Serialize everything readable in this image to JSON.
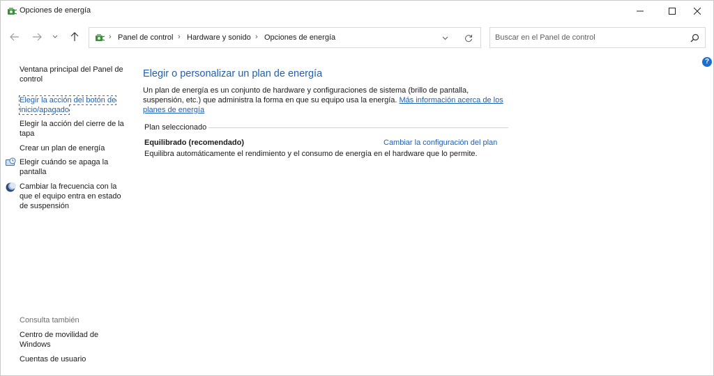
{
  "window": {
    "title": "Opciones de energía"
  },
  "breadcrumb": {
    "items": [
      "Panel de control",
      "Hardware y sonido",
      "Opciones de energía"
    ],
    "separator": "›"
  },
  "search": {
    "placeholder": "Buscar en el Panel de control",
    "value": ""
  },
  "sidebar": {
    "items": [
      {
        "label": "Ventana principal del Panel de control",
        "icon": null
      },
      {
        "label": "Elegir la acción del botón de inicio/apagado",
        "icon": null
      },
      {
        "label": "Elegir la acción del cierre de la tapa",
        "icon": null
      },
      {
        "label": "Crear un plan de energía",
        "icon": null
      },
      {
        "label": "Elegir cuándo se apaga la pantalla",
        "icon": "monitor-clock-icon"
      },
      {
        "label": "Cambiar la frecuencia con la que el equipo entra en estado de suspensión",
        "icon": "moon-icon"
      }
    ],
    "see_also_heading": "Consulta también",
    "see_also": [
      {
        "label": "Centro de movilidad de Windows"
      },
      {
        "label": "Cuentas de usuario"
      }
    ]
  },
  "main": {
    "title": "Elegir o personalizar un plan de energía",
    "description": "Un plan de energía es un conjunto de hardware y configuraciones de sistema (brillo de pantalla, suspensión, etc.) que administra la forma en que su equipo usa la energía.",
    "more_info_link": "Más información acerca de los planes de energía",
    "section_label": "Plan seleccionado",
    "plan": {
      "name": "Equilibrado (recomendado)",
      "change_link": "Cambiar la configuración del plan",
      "description": "Equilibra automáticamente el rendimiento y el consumo de energía en el hardware que lo permite."
    }
  },
  "colors": {
    "link": "#1e5fb4",
    "help_badge": "#1f6fd1"
  }
}
